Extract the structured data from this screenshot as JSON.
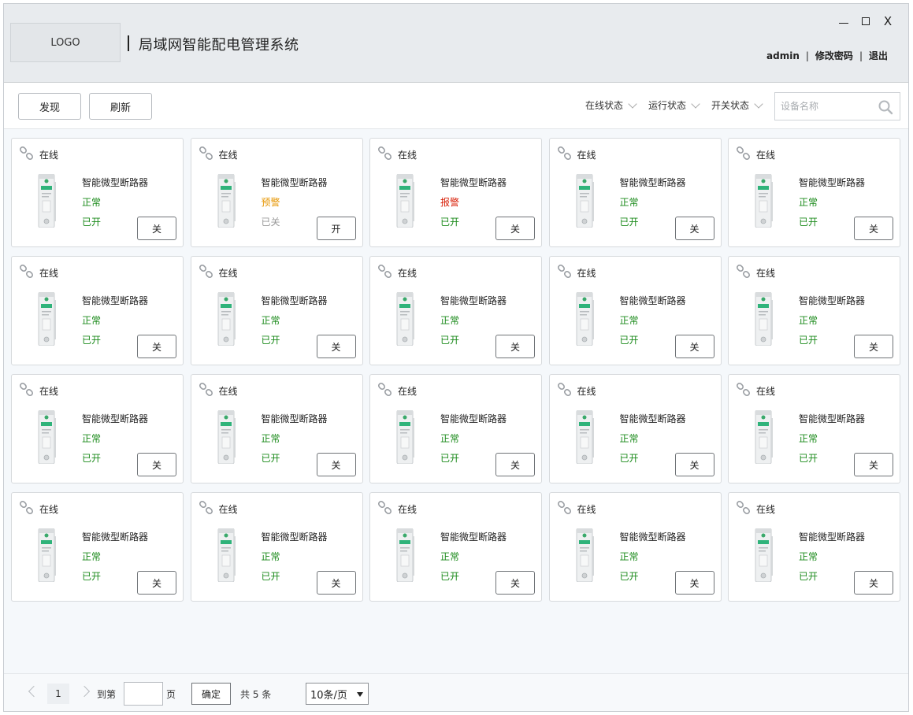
{
  "header": {
    "logo_text": "LOGO",
    "title": "局域网智能配电管理系统",
    "window_controls": {
      "close_label": "X"
    },
    "user": {
      "name": "admin",
      "separator": "|",
      "change_password": "修改密码",
      "logout": "退出"
    }
  },
  "toolbar": {
    "discover_label": "发现",
    "refresh_label": "刷新",
    "filters": [
      "在线状态",
      "运行状态",
      "开关状态"
    ],
    "search": {
      "placeholder": "设备名称",
      "value": ""
    }
  },
  "colors": {
    "normal": "#1a8a1a",
    "warning": "#e69500",
    "alarm": "#d81e06",
    "off": "#999999",
    "on_text": "#1a8a1a"
  },
  "devices": [
    {
      "online": "在线",
      "name": "智能微型断路器",
      "status": "正常",
      "status_color": "#1a8a1a",
      "switch": "已开",
      "switch_color": "#1a8a1a",
      "action": "关"
    },
    {
      "online": "在线",
      "name": "智能微型断路器",
      "status": "预警",
      "status_color": "#e69500",
      "switch": "已关",
      "switch_color": "#999999",
      "action": "开"
    },
    {
      "online": "在线",
      "name": "智能微型断路器",
      "status": "报警",
      "status_color": "#d81e06",
      "switch": "已开",
      "switch_color": "#1a8a1a",
      "action": "关"
    },
    {
      "online": "在线",
      "name": "智能微型断路器",
      "status": "正常",
      "status_color": "#1a8a1a",
      "switch": "已开",
      "switch_color": "#1a8a1a",
      "action": "关"
    },
    {
      "online": "在线",
      "name": "智能微型断路器",
      "status": "正常",
      "status_color": "#1a8a1a",
      "switch": "已开",
      "switch_color": "#1a8a1a",
      "action": "关"
    },
    {
      "online": "在线",
      "name": "智能微型断路器",
      "status": "正常",
      "status_color": "#1a8a1a",
      "switch": "已开",
      "switch_color": "#1a8a1a",
      "action": "关"
    },
    {
      "online": "在线",
      "name": "智能微型断路器",
      "status": "正常",
      "status_color": "#1a8a1a",
      "switch": "已开",
      "switch_color": "#1a8a1a",
      "action": "关"
    },
    {
      "online": "在线",
      "name": "智能微型断路器",
      "status": "正常",
      "status_color": "#1a8a1a",
      "switch": "已开",
      "switch_color": "#1a8a1a",
      "action": "关"
    },
    {
      "online": "在线",
      "name": "智能微型断路器",
      "status": "正常",
      "status_color": "#1a8a1a",
      "switch": "已开",
      "switch_color": "#1a8a1a",
      "action": "关"
    },
    {
      "online": "在线",
      "name": "智能微型断路器",
      "status": "正常",
      "status_color": "#1a8a1a",
      "switch": "已开",
      "switch_color": "#1a8a1a",
      "action": "关"
    },
    {
      "online": "在线",
      "name": "智能微型断路器",
      "status": "正常",
      "status_color": "#1a8a1a",
      "switch": "已开",
      "switch_color": "#1a8a1a",
      "action": "关"
    },
    {
      "online": "在线",
      "name": "智能微型断路器",
      "status": "正常",
      "status_color": "#1a8a1a",
      "switch": "已开",
      "switch_color": "#1a8a1a",
      "action": "关"
    },
    {
      "online": "在线",
      "name": "智能微型断路器",
      "status": "正常",
      "status_color": "#1a8a1a",
      "switch": "已开",
      "switch_color": "#1a8a1a",
      "action": "关"
    },
    {
      "online": "在线",
      "name": "智能微型断路器",
      "status": "正常",
      "status_color": "#1a8a1a",
      "switch": "已开",
      "switch_color": "#1a8a1a",
      "action": "关"
    },
    {
      "online": "在线",
      "name": "智能微型断路器",
      "status": "正常",
      "status_color": "#1a8a1a",
      "switch": "已开",
      "switch_color": "#1a8a1a",
      "action": "关"
    },
    {
      "online": "在线",
      "name": "智能微型断路器",
      "status": "正常",
      "status_color": "#1a8a1a",
      "switch": "已开",
      "switch_color": "#1a8a1a",
      "action": "关"
    },
    {
      "online": "在线",
      "name": "智能微型断路器",
      "status": "正常",
      "status_color": "#1a8a1a",
      "switch": "已开",
      "switch_color": "#1a8a1a",
      "action": "关"
    },
    {
      "online": "在线",
      "name": "智能微型断路器",
      "status": "正常",
      "status_color": "#1a8a1a",
      "switch": "已开",
      "switch_color": "#1a8a1a",
      "action": "关"
    },
    {
      "online": "在线",
      "name": "智能微型断路器",
      "status": "正常",
      "status_color": "#1a8a1a",
      "switch": "已开",
      "switch_color": "#1a8a1a",
      "action": "关"
    },
    {
      "online": "在线",
      "name": "智能微型断路器",
      "status": "正常",
      "status_color": "#1a8a1a",
      "switch": "已开",
      "switch_color": "#1a8a1a",
      "action": "关"
    }
  ],
  "pagination": {
    "current_page": "1",
    "goto_label": "到第",
    "page_input_value": "",
    "page_unit": "页",
    "confirm_label": "确定",
    "total_text": "共 5 条",
    "page_size": "10条/页"
  }
}
